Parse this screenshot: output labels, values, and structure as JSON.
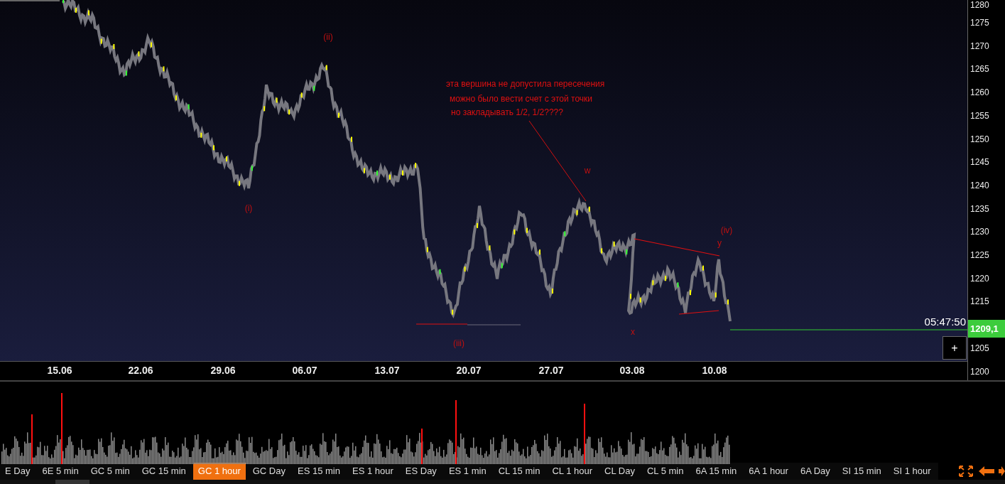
{
  "chart": {
    "wave_labels": [
      "(ii)",
      "(i)",
      "(iii)",
      "w",
      "x",
      "y",
      "(iv)"
    ],
    "note_lines": [
      "эта вершина не допустила пересечения",
      "можно было вести счет с этой точки",
      "но закладывать 1/2, 1/2????"
    ],
    "price_ticks_upper": [
      "1280",
      "1275",
      "1270",
      "1265",
      "1260",
      "1255",
      "1250",
      "1245",
      "1240",
      "1235",
      "1230",
      "1225",
      "1220",
      "1215"
    ],
    "price_ticks_lower": [
      "1205",
      "1200"
    ],
    "date_ticks": [
      "15.06",
      "22.06",
      "29.06",
      "06.07",
      "13.07",
      "20.07",
      "27.07",
      "03.08",
      "10.08"
    ],
    "countdown": "05:47:50",
    "current_price": "1209,1",
    "add_button": "+"
  },
  "tabs": [
    {
      "label": "E Day",
      "selected": false
    },
    {
      "label": "6E 5 min",
      "selected": false
    },
    {
      "label": "GC 5 min",
      "selected": false
    },
    {
      "label": "GC 15 min",
      "selected": false
    },
    {
      "label": "GC 1 hour",
      "selected": true
    },
    {
      "label": "GC Day",
      "selected": false
    },
    {
      "label": "ES 15 min",
      "selected": false
    },
    {
      "label": "ES 1 hour",
      "selected": false
    },
    {
      "label": "ES Day",
      "selected": false
    },
    {
      "label": "ES 1 min",
      "selected": false
    },
    {
      "label": "CL 15 min",
      "selected": false
    },
    {
      "label": "CL 1 hour",
      "selected": false
    },
    {
      "label": "CL Day",
      "selected": false
    },
    {
      "label": "CL 5 min",
      "selected": false
    },
    {
      "label": "6A 15 min",
      "selected": false
    },
    {
      "label": "6A 1 hour",
      "selected": false
    },
    {
      "label": "6A Day",
      "selected": false
    },
    {
      "label": "SI 15 min",
      "selected": false
    },
    {
      "label": "SI 1 hour",
      "selected": false
    }
  ]
}
